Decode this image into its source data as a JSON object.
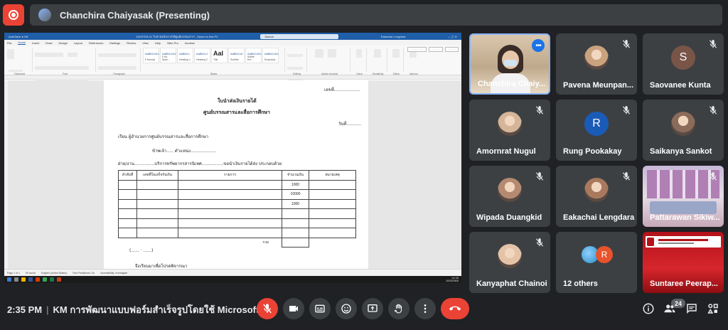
{
  "presenter": {
    "name": "Chanchira Chaiyasak (Presenting)"
  },
  "word": {
    "title": "2021PSS-01 ใบนำส่งเงินรายได้ศูนย์บรรณสารฯ - Saved to this PC",
    "search_placeholder": "Search",
    "user": "Eakachai Lengdara",
    "tabs": [
      "File",
      "Home",
      "Insert",
      "Draw",
      "Design",
      "Layout",
      "References",
      "Mailings",
      "Review",
      "View",
      "Help",
      "Nitro Pro",
      "Acrobat"
    ],
    "groups": [
      "Clipboard",
      "Font",
      "Paragraph",
      "Styles",
      "Editing",
      "Adobe Acrobat",
      "Voice",
      "Sensitivity",
      "Editor",
      "Add-ins"
    ],
    "styles": [
      {
        "sample": "AaBbCcDc",
        "name": "¶ Normal"
      },
      {
        "sample": "AaBbCcDc",
        "name": "¶ No Spac..."
      },
      {
        "sample": "AaBbCc",
        "name": "Heading 1"
      },
      {
        "sample": "AaBbCcI",
        "name": "Heading 2"
      },
      {
        "sample": "AaI",
        "name": "Title"
      },
      {
        "sample": "AaBbCcD",
        "name": "Subtitle"
      },
      {
        "sample": "AaBbCcDc",
        "name": "Subtle Em..."
      },
      {
        "sample": "AaBbCcDc",
        "name": "Emphasis"
      }
    ],
    "comments_label": "Comments",
    "editing_label": "Editing",
    "share_label": "Share",
    "status": [
      "Page 1 of 1",
      "90 words",
      "English (United States)",
      "Text Predictions: On",
      "Accessibility: Investigate"
    ],
    "taskbar_time": "14:35",
    "taskbar_date": "18/3/2565"
  },
  "doc": {
    "no": "เลขที่...................",
    "title1": "ใบนำส่งเงินรายได้",
    "title2": "ศูนย์บรรณสารและสื่อการศึกษา",
    "date": "วันที่...........",
    "to": "เรียน   ผู้อำนวยการศูนย์บรรณสารและสื่อการศึกษา",
    "me": "ข้าพเจ้า.....  ตำแหน่ง...................",
    "dept": "ฝ่าย/งาน...............บริการทรัพยากรสารนิเทศ................ขอนำเงินรายได้ส่ง ประกอบด้วย",
    "headers": [
      "ลำดับที่",
      "เลขที่ใบเสร็จรับเงิน",
      "รายการ",
      "จำนวนเงิน",
      "หมายเหตุ"
    ],
    "amounts": [
      "1000",
      "10000",
      "1000"
    ],
    "total_label": "รวม",
    "sign": "(......  ·  ......)",
    "closing": "จึงเรียนมาเพื่อโปรดพิจารณา"
  },
  "participants": [
    {
      "name": "Chanchira Chaiy...",
      "kind": "video"
    },
    {
      "name": "Pavena Meunpan...",
      "kind": "photo"
    },
    {
      "name": "Saovanee Kunta",
      "kind": "initial",
      "initial": "S",
      "color": "#795548"
    },
    {
      "name": "Amornrat Nugul",
      "kind": "photo"
    },
    {
      "name": "Rung Pookakay",
      "kind": "initial",
      "initial": "R",
      "color": "#1a5bb8"
    },
    {
      "name": "Saikanya Sankot",
      "kind": "photo"
    },
    {
      "name": "Wipada Duangkid",
      "kind": "photo"
    },
    {
      "name": "Eakachai Lengdara",
      "kind": "photo"
    },
    {
      "name": "Pattarawan Sikiw...",
      "kind": "video"
    },
    {
      "name": "Kanyaphat Chainoi",
      "kind": "photo"
    },
    {
      "name": "12 others",
      "kind": "others",
      "initial": "R"
    },
    {
      "name": "Suntaree Peerap...",
      "kind": "video"
    }
  ],
  "bottom": {
    "time": "2:35 PM",
    "meeting_title": "KM การพัฒนาแบบฟอร์มสำเร็จรูปโดยใช้ Microsoft ...",
    "participant_count": "24"
  },
  "colors": {
    "accent": "#8ab4f8",
    "danger": "#ea4335",
    "tile": "#3c4043",
    "bg": "#202124"
  }
}
